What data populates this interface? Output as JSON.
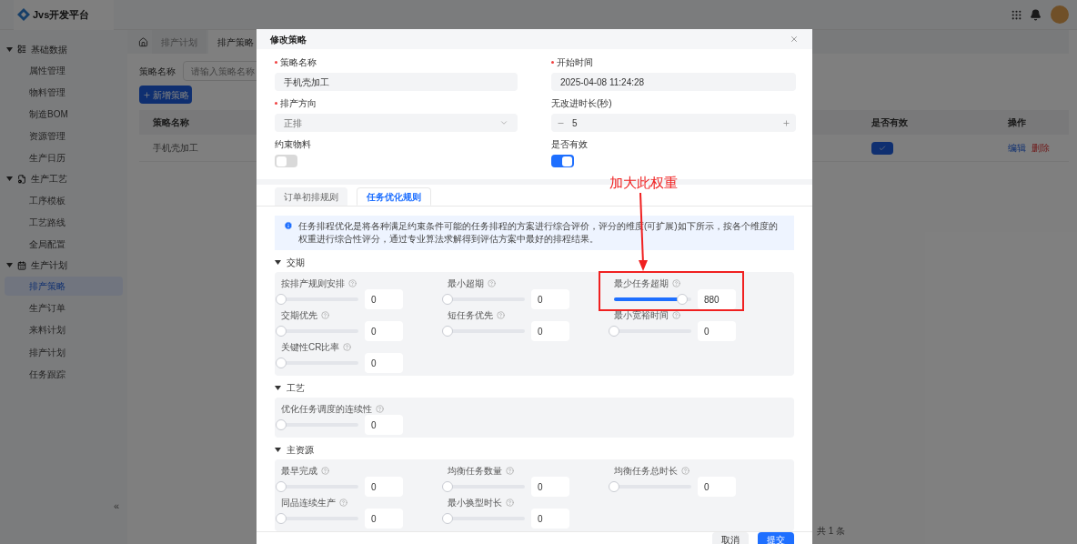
{
  "header": {
    "logo_title": "Jvs开发平台"
  },
  "sidebar": {
    "groups": [
      {
        "label": "基础数据",
        "expanded": true,
        "children": [
          {
            "label": "属性管理",
            "selected": false
          },
          {
            "label": "物料管理",
            "selected": false
          },
          {
            "label": "制造BOM",
            "selected": false
          },
          {
            "label": "资源管理",
            "selected": false
          },
          {
            "label": "生产日历",
            "selected": false
          }
        ]
      },
      {
        "label": "生产工艺",
        "expanded": true,
        "children": [
          {
            "label": "工序模板",
            "selected": false
          },
          {
            "label": "工艺路线",
            "selected": false
          },
          {
            "label": "全局配置",
            "selected": false
          }
        ]
      },
      {
        "label": "生产计划",
        "expanded": true,
        "children": [
          {
            "label": "排产策略",
            "selected": true
          },
          {
            "label": "生产订单",
            "selected": false
          },
          {
            "label": "来料计划",
            "selected": false
          },
          {
            "label": "排产计划",
            "selected": false
          },
          {
            "label": "任务跟踪",
            "selected": false
          }
        ]
      }
    ],
    "collapse": "«"
  },
  "page_tabs": [
    {
      "label": "排产计划",
      "selected": false
    },
    {
      "label": "排产策略",
      "selected": true
    }
  ],
  "search": {
    "label": "策略名称",
    "placeholder": "请输入策略名称"
  },
  "add_button": "新增策略",
  "table": {
    "columns": [
      "策略名称",
      "是否有效",
      "操作"
    ],
    "rows": [
      {
        "name": "手机壳加工",
        "valid": true,
        "actions": [
          "编辑",
          "删除"
        ]
      }
    ]
  },
  "pagination": {
    "total": "共 1 条"
  },
  "dialog": {
    "title": "修改策略",
    "fields": [
      {
        "kind": "text",
        "label": "策略名称",
        "required": true,
        "value": "手机壳加工"
      },
      {
        "kind": "text",
        "label": "开始时间",
        "required": true,
        "value": "2025-04-08 11:24:28"
      },
      {
        "kind": "select",
        "label": "排产方向",
        "required": true,
        "value": "正排"
      },
      {
        "kind": "number",
        "label": "无改进时长(秒)",
        "required": false,
        "value": "5"
      },
      {
        "kind": "switch",
        "label": "约束物料",
        "required": false,
        "on": false
      },
      {
        "kind": "switch",
        "label": "是否有效",
        "required": false,
        "on": true
      }
    ],
    "tabs": [
      {
        "label": "订单初排规则",
        "selected": false
      },
      {
        "label": "任务优化规则",
        "selected": true
      }
    ],
    "info": "任务排程优化是将各种满足约束条件可能的任务排程的方案进行综合评价，评分的维度(可扩展)如下所示，按各个维度的权重进行综合性评分，通过专业算法求解得到评估方案中最好的排程结果。",
    "sections": [
      {
        "title": "交期",
        "expanded": true,
        "items": [
          {
            "label": "按排产规则安排",
            "level": 0,
            "value": "0"
          },
          {
            "label": "最小超期",
            "level": 0,
            "value": "0"
          },
          {
            "label": "最少任务超期",
            "level": 0.88,
            "value": "880",
            "highlighted": true,
            "annotation": "加大此权重"
          },
          {
            "label": "交期优先",
            "level": 0,
            "value": "0"
          },
          {
            "label": "短任务优先",
            "level": 0,
            "value": "0"
          },
          {
            "label": "最小宽裕时间",
            "level": 0,
            "value": "0"
          },
          {
            "label": "关键性CR比率",
            "level": 0,
            "value": "0"
          }
        ]
      },
      {
        "title": "工艺",
        "expanded": true,
        "items": [
          {
            "label": "优化任务调度的连续性",
            "level": 0,
            "value": "0"
          }
        ]
      },
      {
        "title": "主资源",
        "expanded": true,
        "items": [
          {
            "label": "最早完成",
            "level": 0,
            "value": "0"
          },
          {
            "label": "均衡任务数量",
            "level": 0,
            "value": "0"
          },
          {
            "label": "均衡任务总时长",
            "level": 0,
            "value": "0"
          },
          {
            "label": "同品连续生产",
            "level": 0,
            "value": "0"
          },
          {
            "label": "最小换型时长",
            "level": 0,
            "value": "0"
          }
        ]
      }
    ],
    "buttons": [
      {
        "kind": "secondary",
        "label": "取消"
      },
      {
        "kind": "primary",
        "label": "提交"
      }
    ]
  }
}
